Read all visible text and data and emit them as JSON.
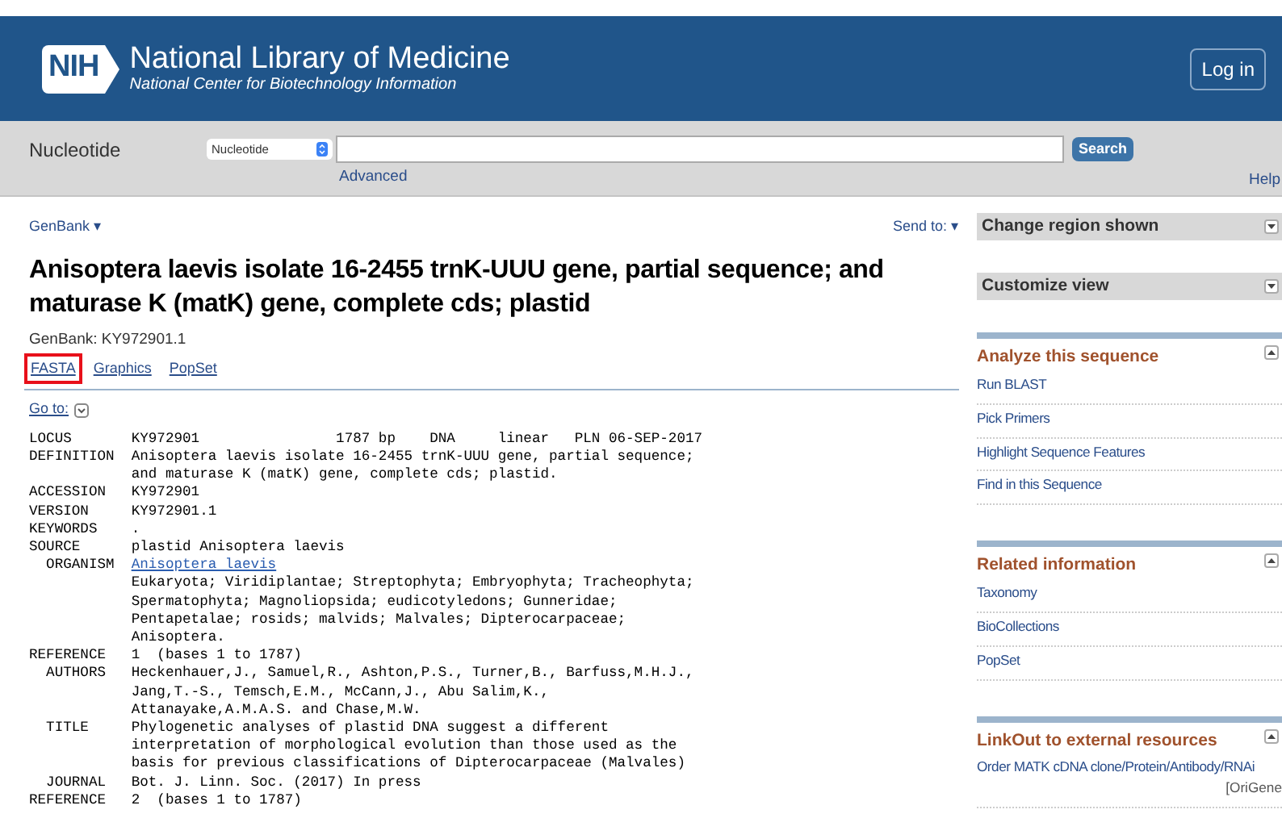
{
  "header": {
    "logo": "NIH",
    "title": "National Library of Medicine",
    "subtitle": "National Center for Biotechnology Information",
    "login": "Log in"
  },
  "search": {
    "database_label": "Nucleotide",
    "database_select": "Nucleotide",
    "button": "Search",
    "advanced": "Advanced",
    "help": "Help"
  },
  "record": {
    "format_menu": "GenBank",
    "format_caret": "▾",
    "send_to": "Send to:",
    "send_caret": "▾",
    "title": "Anisoptera laevis isolate 16-2455 trnK-UUU gene, partial sequence; and maturase K (matK) gene, complete cds; plastid",
    "accession_line": "GenBank: KY972901.1",
    "views": [
      {
        "label": "FASTA",
        "highlighted": true
      },
      {
        "label": "Graphics",
        "highlighted": false
      },
      {
        "label": "PopSet",
        "highlighted": false
      }
    ],
    "goto": "Go to:",
    "fields": [
      {
        "label": "LOCUS",
        "lines": [
          {
            "kind": "text",
            "text": "KY972901                1787 bp    DNA     linear   PLN 06-SEP-2017"
          }
        ]
      },
      {
        "label": "DEFINITION",
        "lines": [
          {
            "kind": "text",
            "text": "Anisoptera laevis isolate 16-2455 trnK-UUU gene, partial sequence;"
          },
          {
            "kind": "text",
            "text": "and maturase K (matK) gene, complete cds; plastid."
          }
        ]
      },
      {
        "label": "ACCESSION",
        "lines": [
          {
            "kind": "text",
            "text": "KY972901"
          }
        ]
      },
      {
        "label": "VERSION",
        "lines": [
          {
            "kind": "text",
            "text": "KY972901.1"
          }
        ]
      },
      {
        "label": "KEYWORDS",
        "lines": [
          {
            "kind": "text",
            "text": "."
          }
        ]
      },
      {
        "label": "SOURCE",
        "lines": [
          {
            "kind": "text",
            "text": "plastid Anisoptera laevis"
          }
        ],
        "children": [
          {
            "label": "ORGANISM",
            "lines": [
              {
                "kind": "link",
                "text": "Anisoptera laevis"
              },
              {
                "kind": "text",
                "text": "Eukaryota; Viridiplantae; Streptophyta; Embryophyta; Tracheophyta;"
              },
              {
                "kind": "text",
                "text": "Spermatophyta; Magnoliopsida; eudicotyledons; Gunneridae;"
              },
              {
                "kind": "text",
                "text": "Pentapetalae; rosids; malvids; Malvales; Dipterocarpaceae;"
              },
              {
                "kind": "text",
                "text": "Anisoptera."
              }
            ]
          }
        ]
      },
      {
        "label": "REFERENCE",
        "lines": [
          {
            "kind": "text",
            "text": "1  (bases 1 to 1787)"
          }
        ],
        "children": [
          {
            "label": "AUTHORS",
            "lines": [
              {
                "kind": "text",
                "text": "Heckenhauer,J., Samuel,R., Ashton,P.S., Turner,B., Barfuss,M.H.J.,"
              },
              {
                "kind": "text",
                "text": "Jang,T.-S., Temsch,E.M., McCann,J., Abu Salim,K.,"
              },
              {
                "kind": "text",
                "text": "Attanayake,A.M.A.S. and Chase,M.W."
              }
            ]
          },
          {
            "label": "TITLE",
            "lines": [
              {
                "kind": "text",
                "text": "Phylogenetic analyses of plastid DNA suggest a different"
              },
              {
                "kind": "text",
                "text": "interpretation of morphological evolution than those used as the"
              },
              {
                "kind": "text",
                "text": "basis for previous classifications of Dipterocarpaceae (Malvales)"
              }
            ]
          },
          {
            "label": "JOURNAL",
            "lines": [
              {
                "kind": "text",
                "text": "Bot. J. Linn. Soc. (2017) In press"
              }
            ]
          }
        ]
      },
      {
        "label": "REFERENCE",
        "lines": [
          {
            "kind": "text",
            "text": "2  (bases 1 to 1787)"
          }
        ]
      }
    ]
  },
  "sidebar": [
    {
      "title": "Change region shown",
      "expanded": false
    },
    {
      "title": "Customize view",
      "expanded": false
    },
    {
      "title": "Analyze this sequence",
      "expanded": true,
      "items": [
        {
          "label": "Run BLAST"
        },
        {
          "label": "Pick Primers"
        },
        {
          "label": "Highlight Sequence Features"
        },
        {
          "label": "Find in this Sequence"
        }
      ]
    },
    {
      "title": "Related information",
      "expanded": true,
      "items": [
        {
          "label": "Taxonomy"
        },
        {
          "label": "BioCollections"
        },
        {
          "label": "PopSet"
        }
      ]
    },
    {
      "title": "LinkOut to external resources",
      "expanded": true,
      "items": [
        {
          "label": "Order MATK cDNA clone/Protein/Antibody/RNAi",
          "source": "[OriGene"
        }
      ]
    }
  ]
}
